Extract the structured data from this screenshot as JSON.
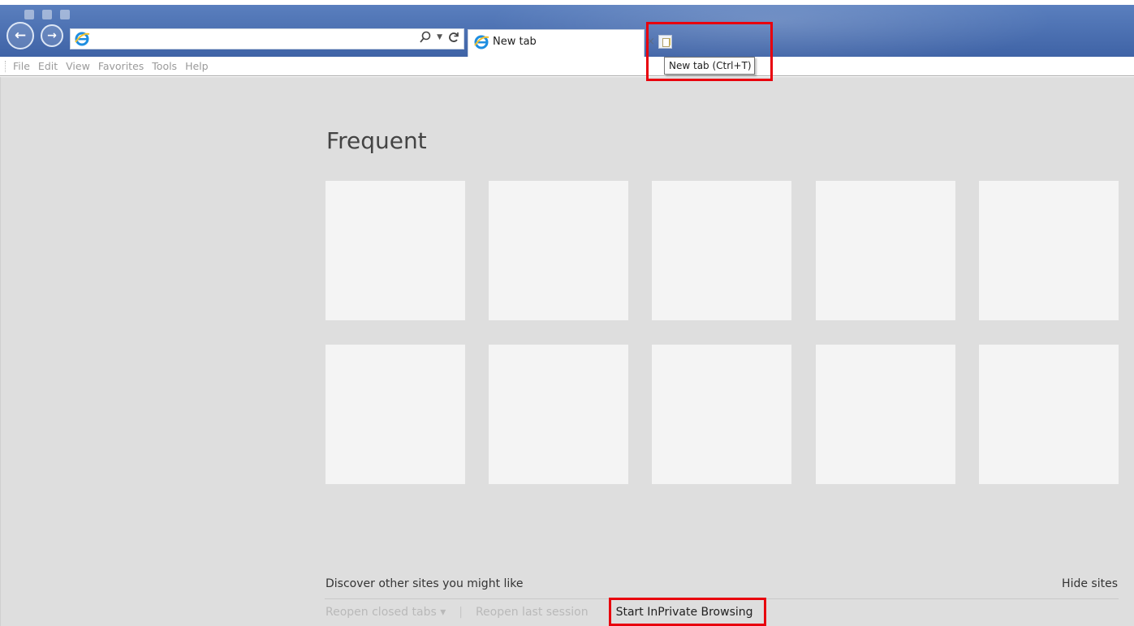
{
  "browser": {
    "address": {
      "value": "",
      "search_icon": "search-icon",
      "refresh_icon": "refresh-icon"
    },
    "tab": {
      "title": "New tab",
      "close_label": "×"
    },
    "new_tab_tooltip": "New tab (Ctrl+T)",
    "back_label": "←",
    "forward_label": "→"
  },
  "menu": {
    "items": [
      "File",
      "Edit",
      "View",
      "Favorites",
      "Tools",
      "Help"
    ]
  },
  "page": {
    "heading": "Frequent",
    "tiles_count": 10,
    "discover": "Discover other sites you might like",
    "hide_sites": "Hide sites",
    "reopen_closed_tabs": "Reopen closed tabs ▾",
    "separator": "|",
    "reopen_last_session": "Reopen last session",
    "start_inprivate": "Start InPrivate Browsing"
  },
  "colors": {
    "accent_blue": "#4a6fb3",
    "highlight_red": "#e8000d",
    "content_bg": "#dedede",
    "tile_bg": "#f4f4f4"
  }
}
